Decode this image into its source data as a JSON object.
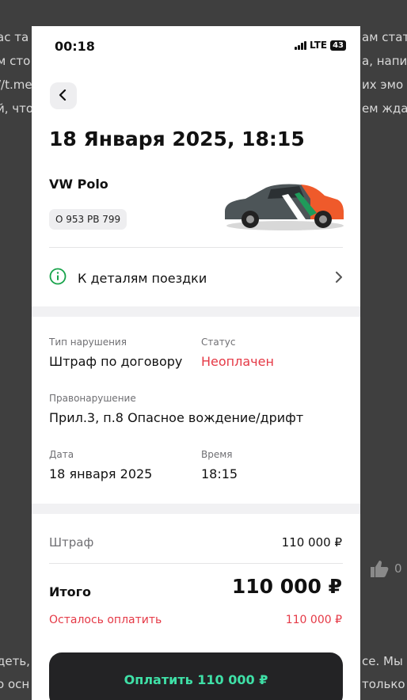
{
  "background": {
    "lines_left": [
      "ас та",
      "м сто",
      "//t.me",
      "й, что"
    ],
    "lines_right": [
      "ам стат",
      "а, напи",
      "их эмо",
      "ем жда"
    ],
    "bottom_left": [
      "деть,",
      "о осн"
    ],
    "bottom_right": [
      "се. Мы",
      "только"
    ],
    "like_count": "0"
  },
  "status_bar": {
    "time": "00:18",
    "network": "LTE",
    "battery": "43"
  },
  "header": {
    "title": "18 Января 2025, 18:15"
  },
  "car": {
    "name": "VW Polo",
    "plate": "О 953 РВ 799"
  },
  "details_link": {
    "label": "К деталям поездки"
  },
  "violation": {
    "type_label": "Тип нарушения",
    "type_value": "Штраф по договору",
    "status_label": "Статус",
    "status_value": "Неоплачен",
    "offense_label": "Правонарушение",
    "offense_value": "Прил.3, п.8 Опасное вождение/дрифт",
    "date_label": "Дата",
    "date_value": "18 января 2025",
    "time_label": "Время",
    "time_value": "18:15"
  },
  "summary": {
    "fine_label": "Штраф",
    "fine_value": "110 000 ₽",
    "total_label": "Итого",
    "total_value": "110 000 ₽",
    "remaining_label": "Осталось оплатить",
    "remaining_value": "110 000 ₽"
  },
  "pay_button": {
    "label": "Оплатить 110 000 ₽"
  },
  "colors": {
    "accent_red": "#e53946",
    "pay_text": "#3fe0a7",
    "pay_bg": "#232325",
    "info_green": "#17a34a"
  }
}
